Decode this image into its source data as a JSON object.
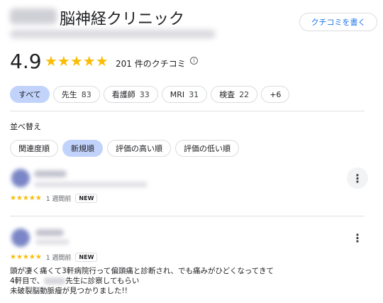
{
  "place": {
    "name_suffix": "脳神経クリニック",
    "write_review_label": "クチコミを書く"
  },
  "summary": {
    "rating": "4.9",
    "stars": "★★★★★",
    "review_count": "201 件のクチコミ",
    "info_icon": "ⓘ"
  },
  "topic_chips": [
    {
      "label": "すべて",
      "count": ""
    },
    {
      "label": "先生",
      "count": "83"
    },
    {
      "label": "看護師",
      "count": "33"
    },
    {
      "label": "MRI",
      "count": "31"
    },
    {
      "label": "検査",
      "count": "22"
    },
    {
      "label": "+6",
      "count": ""
    }
  ],
  "sort": {
    "label": "並べ替え",
    "options": [
      "関連度順",
      "新規順",
      "評価の高い順",
      "評価の低い順"
    ],
    "selected": "新規順"
  },
  "reviews": [
    {
      "stars": "★★★★★",
      "time": "1 週間前",
      "badge": "NEW",
      "more": "⋮",
      "text": []
    },
    {
      "stars": "★★★★★",
      "time": "1 週間前",
      "badge": "NEW",
      "more": "⋮",
      "text_line1": "頭が凄く痛くて3軒病院行って偏頭痛と診断され、でも痛みがひどくなってきて",
      "text_line2_pre": "4軒目で、",
      "text_line2_post": "先生に診察してもらい",
      "text_line3": "未破裂脳動脈瘤が見つかりました!!"
    }
  ],
  "colors": {
    "star": "#fbbc04",
    "accent": "#1a73e8",
    "chip_active": "#c2d3fb"
  }
}
